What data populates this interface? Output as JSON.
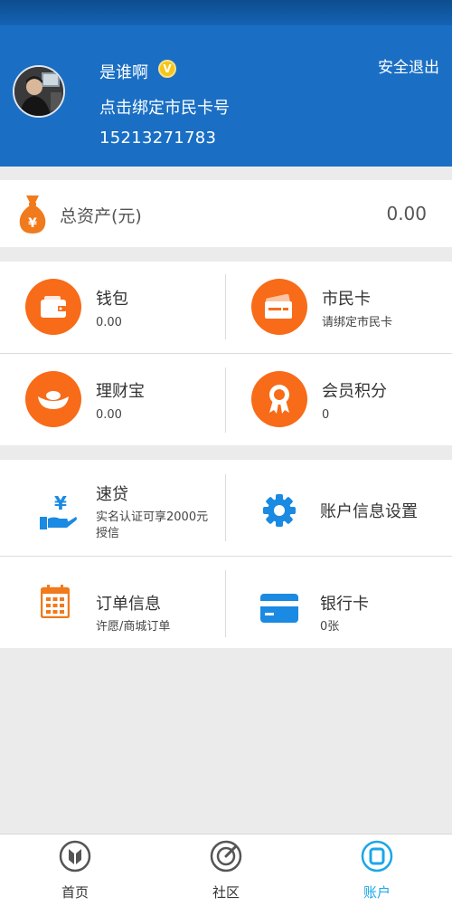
{
  "header": {
    "username": "是谁啊",
    "vip_badge": "V",
    "bind_card_prompt": "点击绑定市民卡号",
    "phone": "15213271783",
    "logout_label": "安全退出",
    "bg_color": "#1a6fc4"
  },
  "assets": {
    "label": "总资产(元)",
    "value": "0.00",
    "icon": "money-bag-icon"
  },
  "accounts": [
    {
      "title": "钱包",
      "sub": "0.00",
      "icon": "wallet-icon"
    },
    {
      "title": "市民卡",
      "sub": "请绑定市民卡",
      "icon": "citizen-card-icon"
    },
    {
      "title": "理财宝",
      "sub": "0.00",
      "icon": "ingot-icon"
    },
    {
      "title": "会员积分",
      "sub": "0",
      "icon": "medal-icon"
    }
  ],
  "services": [
    {
      "title": "速贷",
      "sub": "实名认证可享2000元授信",
      "icon": "loan-hand-yen-icon"
    },
    {
      "title": "账户信息设置",
      "sub": "",
      "icon": "gear-icon"
    },
    {
      "title": "订单信息",
      "sub": "许愿/商城订单",
      "icon": "calendar-icon"
    },
    {
      "title": "银行卡",
      "sub": "0张",
      "icon": "bank-card-icon"
    }
  ],
  "tabbar": {
    "tabs": [
      {
        "label": "首页",
        "icon": "home-logo-icon",
        "active": false
      },
      {
        "label": "社区",
        "icon": "community-radar-icon",
        "active": false
      },
      {
        "label": "账户",
        "icon": "account-icon",
        "active": true
      }
    ],
    "active_color": "#1aa7e8"
  },
  "colors": {
    "accent_orange": "#f86b18",
    "icon_blue": "#1a8ae2"
  }
}
